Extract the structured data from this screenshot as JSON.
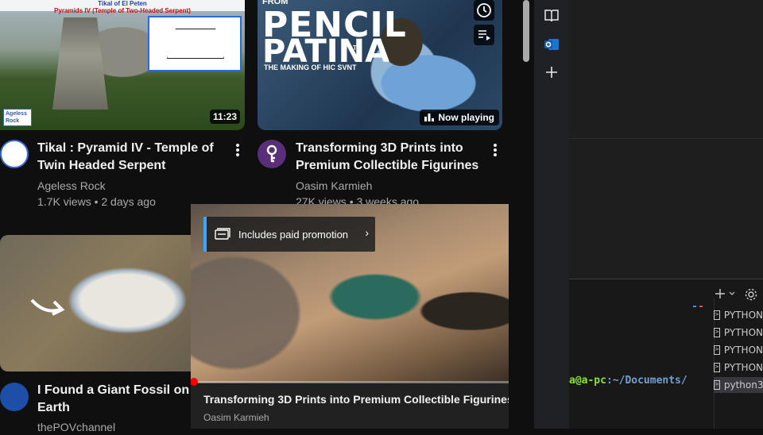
{
  "videos": [
    {
      "title_line1": "Tikal : Pyramid IV - Temple of",
      "title_line2": "Twin Headed Serpent",
      "channel": "Ageless Rock",
      "stats": "1.7K views • 2 days ago",
      "duration": "11:23",
      "thumb_header1": "Tikal of El Peten",
      "thumb_header2": "Pyramids IV (Temple of Two-Headed Serpent)",
      "thumb_logo": "Ageless Rock"
    },
    {
      "title_line1": "Transforming 3D Prints into",
      "title_line2": "Premium Collectible Figurines",
      "channel": "Oasim Karmieh",
      "stats": "27K views • 3 weeks ago",
      "badge": "Now playing",
      "thumb_from": "FROM",
      "thumb_big1": "PENCIL",
      "thumb_big2": "PATINA",
      "thumb_to": "TO",
      "thumb_sub": "THE MAKING OF HIC SVNT"
    },
    {
      "title_line1": "I Found a Giant Fossil on Go",
      "title_line2": "Earth",
      "channel": "thePOVchannel"
    }
  ],
  "miniplayer": {
    "promo": "Includes paid promotion",
    "title": "Transforming 3D Prints into Premium Collectible Figurines",
    "channel": "Oasim Karmieh",
    "progress": 0.01
  },
  "terminal": {
    "tabs": [
      "PYTHON",
      "PYTHON",
      "PYTHON",
      "PYTHON",
      "python3"
    ],
    "prompt_user": "a@a-pc",
    "prompt_path": ":~/Documents/"
  },
  "colors": {
    "accent": "#ff0000",
    "link": "#3ea6ff",
    "prompt_green": "#8ae234",
    "prompt_blue": "#729fcf"
  }
}
